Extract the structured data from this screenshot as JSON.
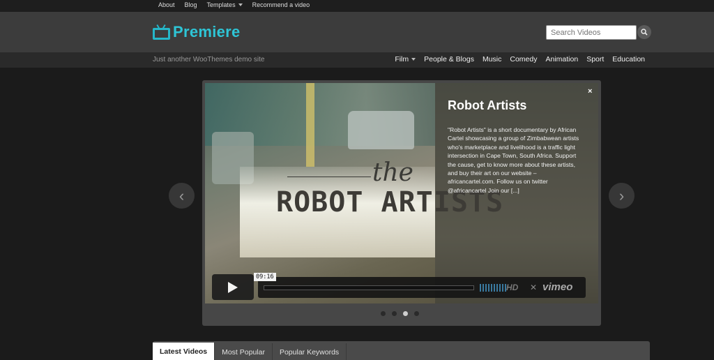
{
  "topnav": {
    "items": [
      "About",
      "Blog",
      "Templates",
      "Recommend a video"
    ]
  },
  "header": {
    "logo_text": "Premiere",
    "search_placeholder": "Search Videos"
  },
  "subbar": {
    "tagline": "Just another WooThemes demo site",
    "nav": [
      "Film",
      "People & Blogs",
      "Music",
      "Comedy",
      "Animation",
      "Sport",
      "Education"
    ]
  },
  "slider": {
    "video_overlay_the": "the",
    "video_overlay_title": "ROBOT ARTISTS",
    "title": "Robot Artists",
    "description": "\"Robot Artists\" is a short documentary by African Cartel showcasing a group of Zimbabwean artists who's marketplace and livelihood is a traffic light intersection in Cape Town, South Africa. Support the cause, get to know more about these artists, and buy their art on our website – africancartel.com. Follow us on twitter @africancartel Join our [...]",
    "close_label": "×",
    "timecode": "09:16",
    "hd_label": "HD",
    "vimeo_label": "vimeo",
    "active_dot": 3,
    "prev_label": "‹",
    "next_label": "›"
  },
  "tabs": [
    "Latest Videos",
    "Most Popular",
    "Popular Keywords"
  ],
  "colors": {
    "accent": "#2ec5d6",
    "background": "#1b1b1b"
  }
}
